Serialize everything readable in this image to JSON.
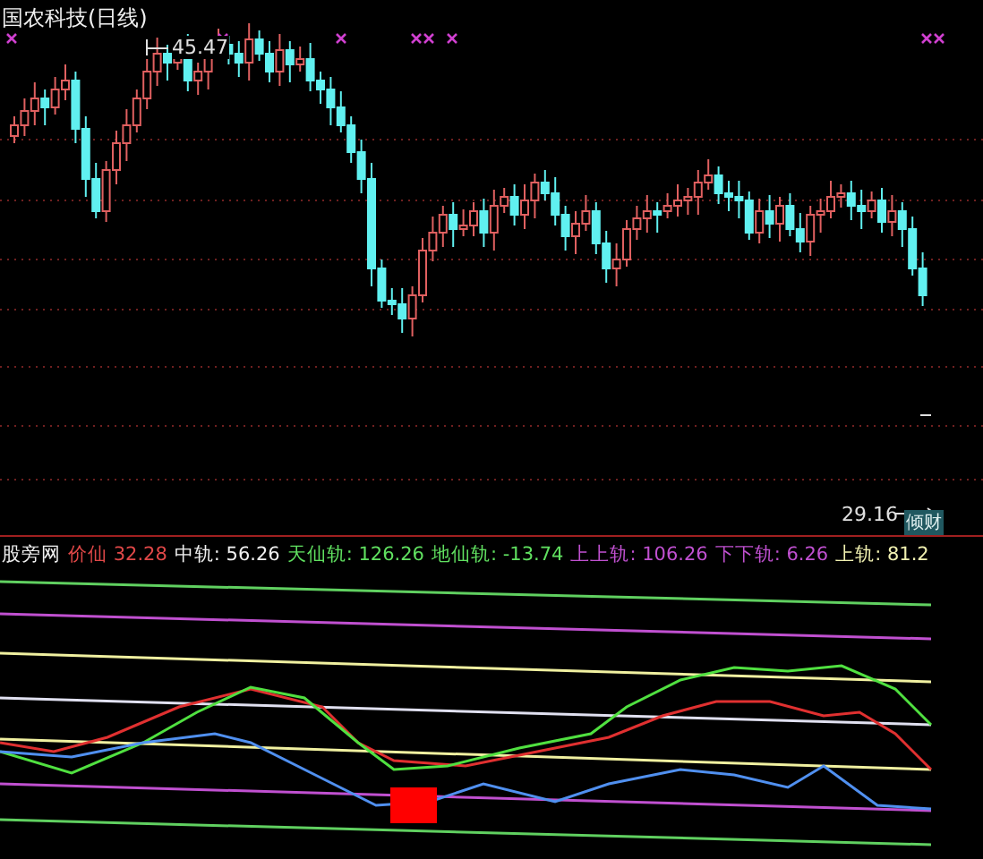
{
  "chart_panel": {
    "title": "国农科技(日线)",
    "high_label": "45.47",
    "low_label": "29.16",
    "tag": "倾财"
  },
  "indicator_panel": {
    "name": "股旁网",
    "values": [
      {
        "label": "价仙",
        "value": "32.28",
        "color": "#e04848"
      },
      {
        "label": "中轨:",
        "value": "56.26",
        "color": "#f0f0f0"
      },
      {
        "label": "天仙轨:",
        "value": "126.26",
        "color": "#60e060"
      },
      {
        "label": "地仙轨:",
        "value": "-13.74",
        "color": "#60e060"
      },
      {
        "label": "上上轨:",
        "value": "106.26",
        "color": "#c050d0"
      },
      {
        "label": "下下轨:",
        "value": "6.26",
        "color": "#c050d0"
      },
      {
        "label": "上轨:",
        "value": "81.2",
        "color": "#f0f0b0"
      }
    ]
  }
}
